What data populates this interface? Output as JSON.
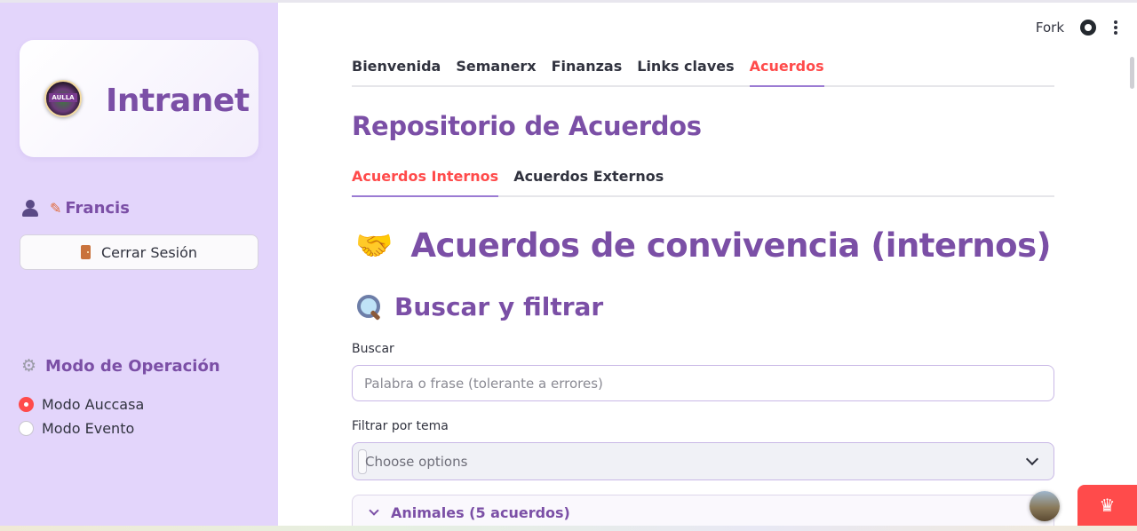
{
  "sidebar": {
    "logo_text": "Intranet",
    "logo_badge_text": "AULLA",
    "user_name": "Francis",
    "logout_label": "Cerrar Sesión",
    "mode_title": "Modo de Operación",
    "modes": [
      {
        "label": "Modo Auccasa",
        "selected": true
      },
      {
        "label": "Modo Evento",
        "selected": false
      }
    ]
  },
  "header": {
    "fork_label": "Fork"
  },
  "main": {
    "tabs": [
      {
        "label": "Bienvenida",
        "active": false
      },
      {
        "label": "Semanerx",
        "active": false
      },
      {
        "label": "Finanzas",
        "active": false
      },
      {
        "label": "Links claves",
        "active": false
      },
      {
        "label": "Acuerdos",
        "active": true
      }
    ],
    "repo_title": "Repositorio de Acuerdos",
    "subtabs": [
      {
        "label": "Acuerdos Internos",
        "active": true
      },
      {
        "label": "Acuerdos Externos",
        "active": false
      }
    ],
    "heading": "Acuerdos de convivencia (internos)",
    "search_heading": "Buscar y filtrar",
    "search": {
      "label": "Buscar",
      "placeholder": "Palabra o frase (tolerante a errores)",
      "value": ""
    },
    "filter": {
      "label": "Filtrar por tema",
      "placeholder": "Choose options"
    },
    "expander_label": "Animales (5 acuerdos)"
  },
  "colors": {
    "accent_purple": "#7b4fa6",
    "active_red": "#ff4b4b",
    "sidebar_bg": "#e3d5fb"
  },
  "icons": [
    "user-icon",
    "pencil-icon",
    "door-icon",
    "gear-icon",
    "github-icon",
    "kebab-menu-icon",
    "handshake-icon",
    "magnifier-icon",
    "chevron-down-icon",
    "crown-icon"
  ]
}
